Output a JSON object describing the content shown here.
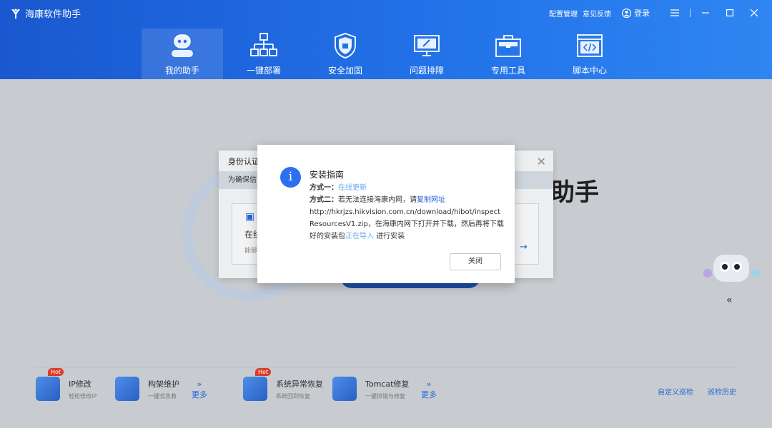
{
  "app": {
    "title": "海康软件助手"
  },
  "top_bar": {
    "config": "配置管理",
    "feedback": "意见反馈",
    "login": "登录"
  },
  "nav": [
    {
      "label": "我的助手",
      "icon": "robot-icon",
      "active": true
    },
    {
      "label": "一键部署",
      "icon": "network-icon"
    },
    {
      "label": "安全加固",
      "icon": "shield-icon"
    },
    {
      "label": "问题排障",
      "icon": "monitor-tools-icon"
    },
    {
      "label": "专用工具",
      "icon": "toolbox-icon"
    },
    {
      "label": "脚本中心",
      "icon": "code-window-icon"
    }
  ],
  "main": {
    "big_title": "助手"
  },
  "back_dialog": {
    "title": "身份认证",
    "subtitle": "为确保信",
    "card_title": "在线",
    "card_desc": "能够"
  },
  "modal": {
    "title": "安装指南",
    "method1_label": "方式一：",
    "method1_link": "在线更新",
    "method2_label": "方式二：",
    "method2_text": "若无法连接海康内网，请",
    "method2_link": "复制网址",
    "url_text": "http://hkrjzs.hikvision.com.cn/download/hibot/inspectResourcesV1.zip，在海康内网下打开并下载，然后再将下载好的安装包",
    "import_link": "正在导入",
    "tail_text": "进行安装",
    "close_label": "关闭"
  },
  "tools": [
    {
      "name": "IP修改",
      "desc": "轻松修改IP",
      "hot": "Hot"
    },
    {
      "name": "构架维护",
      "desc": "一键式急救"
    },
    {
      "name": "系统异常恢复",
      "desc": "系统回到恢复",
      "hot": "Hot"
    },
    {
      "name": "Tomcat修复",
      "desc": "一键排错与修复"
    }
  ],
  "more_label": "更多",
  "right_links": {
    "custom": "自定义巡检",
    "history": "巡检历史"
  },
  "colors": {
    "header_start": "#1a58cf",
    "header_end": "#2f86f2",
    "accent": "#2465d8",
    "hot": "#d93c2a"
  }
}
